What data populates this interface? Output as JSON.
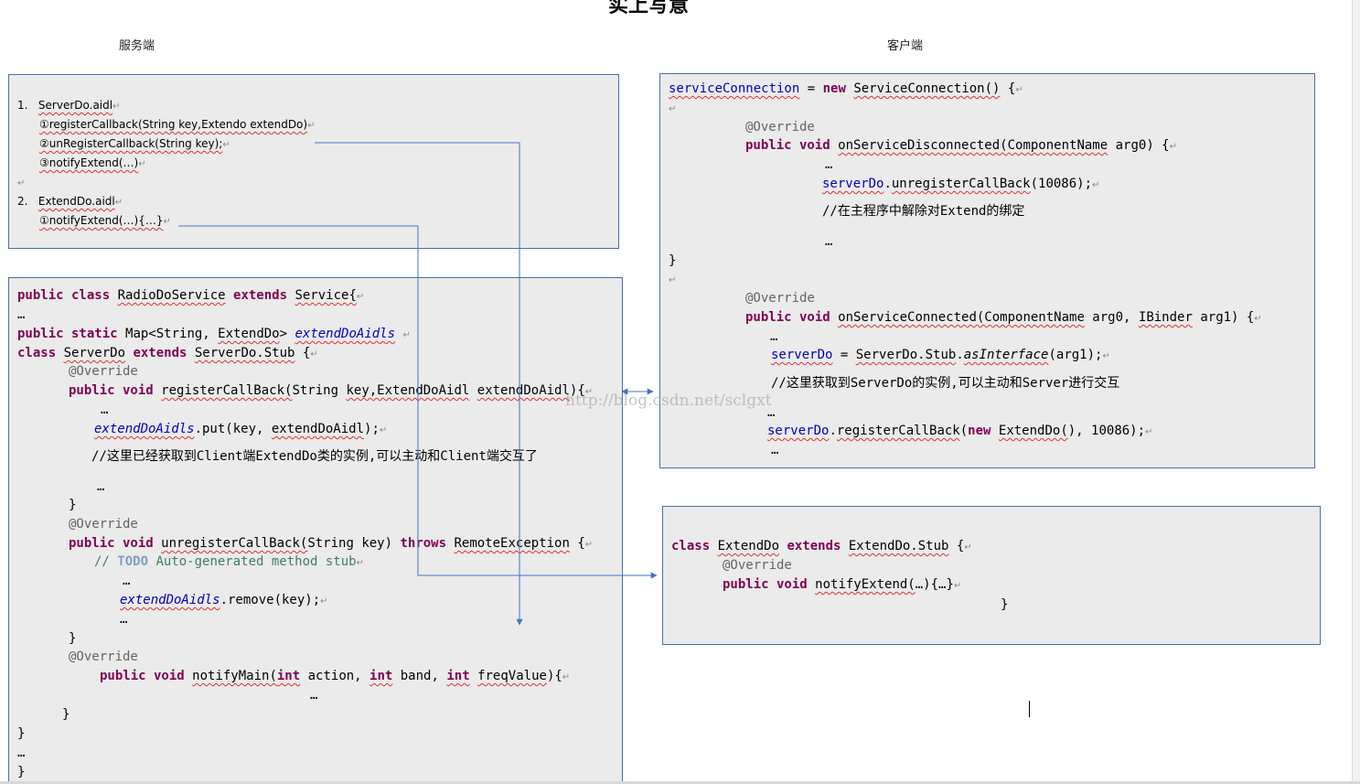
{
  "title_fragment": "实上写意",
  "labels": {
    "server": "服务端",
    "client": "客户端"
  },
  "aidl_box": {
    "items": [
      {
        "num": "1.",
        "name": "ServerDo.aidl"
      },
      {
        "num": "",
        "name": "①registerCallback(String key,Extendo extendDo)"
      },
      {
        "num": "",
        "name": "②unRegisterCallback(String key);"
      },
      {
        "num": "",
        "name": "③notifyExtend(…)"
      },
      {
        "num": "2.",
        "name": "ExtendDo.aidl"
      },
      {
        "num": "",
        "name": "①notifyExtend(…){…}"
      }
    ]
  },
  "server_code": [
    "public class RadioDoService extends Service{",
    "…",
    "public static Map<String, ExtendDo> extendDoAidls",
    "class ServerDo extends ServerDo.Stub {",
    "@Override",
    "public void registerCallBack(String key,ExtendDoAidl extendDoAidl){",
    "…",
    "extendDoAidls.put(key, extendDoAidl);",
    "//这里已经获取到Client端ExtendDo类的实例,可以主动和Client端交互了",
    "…",
    "}",
    "@Override",
    "public void unregisterCallBack(String key) throws RemoteException {",
    "// TODO Auto-generated method stub",
    "…",
    "extendDoAidls.remove(key);",
    "…",
    "}",
    "@Override",
    "public void notifyMain(int action, int band, int freqValue){",
    "…",
    "}",
    "}",
    "…",
    "}"
  ],
  "client_code": [
    "serviceConnection = new ServiceConnection() {",
    "@Override",
    "public void onServiceDisconnected(ComponentName arg0) {",
    "…",
    "serverDo.unregisterCallBack(10086);",
    "//在主程序中解除对Extend的绑定",
    "…",
    "}",
    "@Override",
    "public void onServiceConnected(ComponentName arg0, IBinder arg1) {",
    "…",
    "serverDo = ServerDo.Stub.asInterface(arg1);",
    "//这里获取到ServerDo的实例,可以主动和Server进行交互",
    "…",
    "serverDo.registerCallBack(new ExtendDo(), 10086);",
    "…"
  ],
  "extend_code": [
    "class ExtendDo extends ExtendDo.Stub {",
    "@Override",
    "public void notifyExtend(…){…}",
    "}"
  ],
  "watermark": "http://blog.csdn.net/sclgxt",
  "colors": {
    "arrow": "#4472c4",
    "box_border": "#4a6fa5",
    "box_fill": "#ebebeb",
    "keyword": "#7f0055",
    "field": "#0000c0"
  }
}
